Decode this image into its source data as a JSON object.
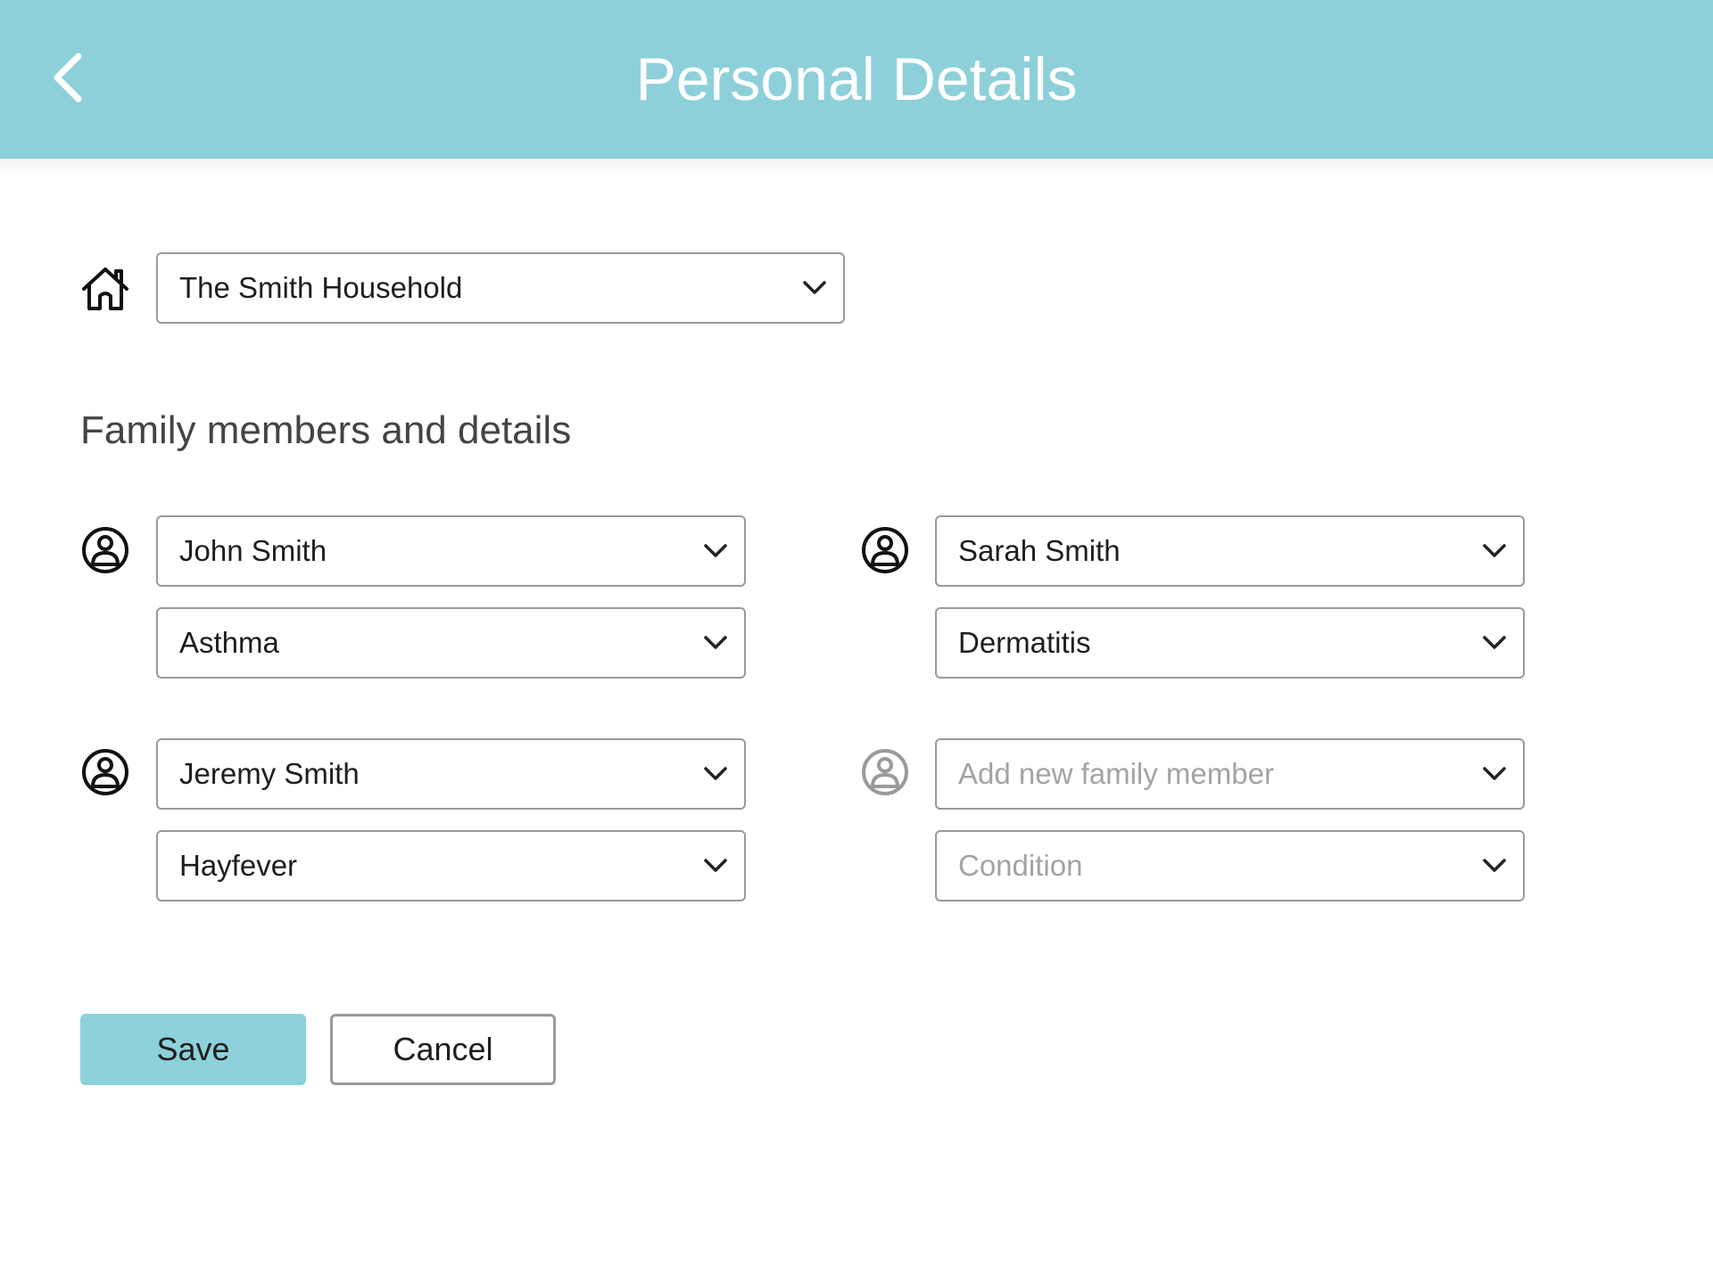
{
  "header": {
    "title": "Personal Details",
    "back_icon": "chevron-left-icon",
    "background_color": "#8dd0da"
  },
  "household": {
    "icon": "home-icon",
    "selected": "The Smith Household"
  },
  "family_section": {
    "title": "Family members and details"
  },
  "members": [
    {
      "name": "John Smith",
      "condition": "Asthma",
      "icon": "user-circle-icon"
    },
    {
      "name": "Sarah Smith",
      "condition": "Dermatitis",
      "icon": "user-circle-icon"
    },
    {
      "name": "Jeremy Smith",
      "condition": "Hayfever",
      "icon": "user-circle-icon"
    }
  ],
  "new_member": {
    "name_placeholder": "Add new family member",
    "condition_placeholder": "Condition",
    "icon": "user-circle-icon"
  },
  "actions": {
    "save_label": "Save",
    "cancel_label": "Cancel",
    "save_color": "#8dd0da"
  }
}
